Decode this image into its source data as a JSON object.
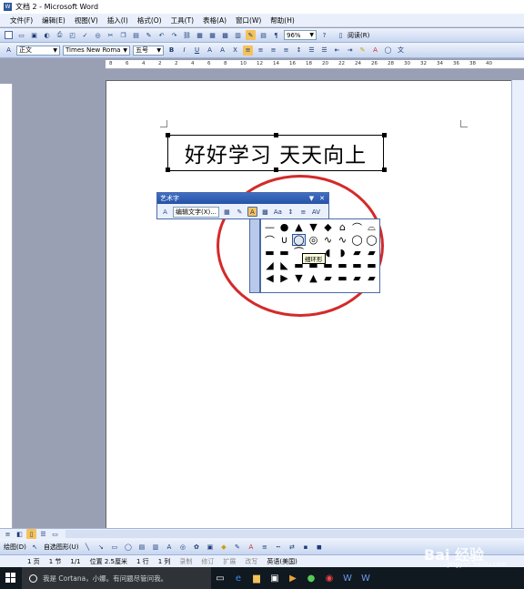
{
  "window": {
    "title": "文档 2 - Microsoft Word"
  },
  "menu": [
    "文件(F)",
    "编辑(E)",
    "视图(V)",
    "插入(I)",
    "格式(O)",
    "工具(T)",
    "表格(A)",
    "窗口(W)",
    "帮助(H)"
  ],
  "standard_toolbar": {
    "zoom": "96%",
    "read_label": "阅读(R)"
  },
  "format_toolbar": {
    "style": "正文",
    "font": "Times New Roma",
    "size": "五号",
    "bold": "B",
    "italic": "I",
    "underline": "U"
  },
  "ruler_numbers": [
    "8",
    "6",
    "4",
    "2",
    "2",
    "4",
    "6",
    "8",
    "10",
    "12",
    "14",
    "16",
    "18",
    "20",
    "22",
    "24",
    "26",
    "28",
    "30",
    "32",
    "34",
    "36",
    "38",
    "40"
  ],
  "document": {
    "wordart_text": "好好学习 天天向上"
  },
  "wordart_toolbar": {
    "title": "艺术字",
    "edit_label": "编辑文字(X)..."
  },
  "shape_tooltip": "细环形",
  "drawing_toolbar": {
    "draw_label": "绘图(D)",
    "autoshapes_label": "自选图形(U)"
  },
  "status": {
    "page": "1 页",
    "section": "1 节",
    "pages": "1/1",
    "position": "位置 2.5厘米",
    "line": "1 行",
    "column": "1 列",
    "rec": "录制",
    "trk": "修订",
    "ext": "扩展",
    "ovr": "改写",
    "lang": "英语(美国)"
  },
  "taskbar": {
    "cortana_placeholder": "我是 Cortana，小娜。有问题尽管问我。"
  },
  "watermark": {
    "brand": "Bai 经验",
    "url": "jingyan.baidu.com"
  },
  "colors": {
    "accent": "#2553a6",
    "circle": "#d42a2a",
    "taskbar": "#101820"
  }
}
